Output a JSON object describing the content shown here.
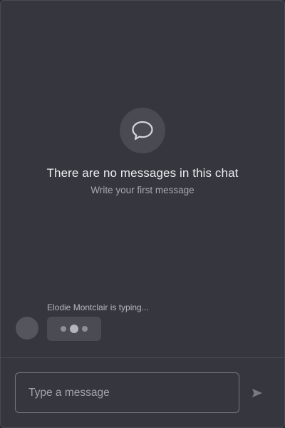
{
  "empty_state": {
    "icon": "chat-bubble-icon",
    "title": "There are no messages in this chat",
    "subtitle": "Write your first message"
  },
  "typing_indicator": {
    "label": "Elodie Montclair is typing..."
  },
  "composer": {
    "value": "",
    "placeholder": "Type a message",
    "send_icon": "send-icon"
  },
  "colors": {
    "window_background": "#36363e",
    "border": "#4a4a53",
    "input_border": "#77777f",
    "bubble": "#4b4b53",
    "primary_text": "#ececf0",
    "secondary_text": "#a8a8b0"
  }
}
